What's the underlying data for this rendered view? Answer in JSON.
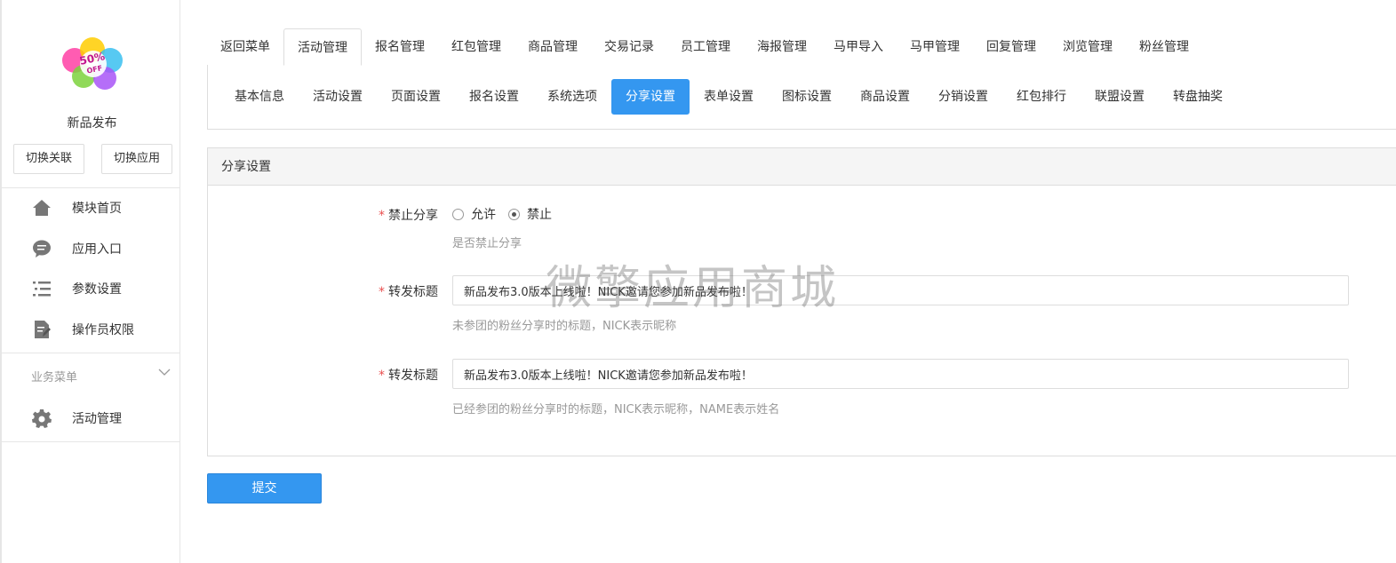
{
  "sidebar": {
    "app_name": "新品发布",
    "switch_link_label": "切换关联",
    "switch_app_label": "切换应用",
    "items": [
      {
        "label": "模块首页",
        "icon": "home-icon"
      },
      {
        "label": "应用入口",
        "icon": "chat-icon"
      },
      {
        "label": "参数设置",
        "icon": "list-icon"
      },
      {
        "label": "操作员权限",
        "icon": "document-edit-icon"
      }
    ],
    "business_menu_title": "业务菜单",
    "business_items": [
      {
        "label": "活动管理",
        "icon": "gear-icon"
      }
    ]
  },
  "top_tabs": [
    {
      "label": "返回菜单",
      "active": false
    },
    {
      "label": "活动管理",
      "active": true
    },
    {
      "label": "报名管理",
      "active": false
    },
    {
      "label": "红包管理",
      "active": false
    },
    {
      "label": "商品管理",
      "active": false
    },
    {
      "label": "交易记录",
      "active": false
    },
    {
      "label": "员工管理",
      "active": false
    },
    {
      "label": "海报管理",
      "active": false
    },
    {
      "label": "马甲导入",
      "active": false
    },
    {
      "label": "马甲管理",
      "active": false
    },
    {
      "label": "回复管理",
      "active": false
    },
    {
      "label": "浏览管理",
      "active": false
    },
    {
      "label": "粉丝管理",
      "active": false
    }
  ],
  "sub_tabs": [
    {
      "label": "基本信息",
      "active": false
    },
    {
      "label": "活动设置",
      "active": false
    },
    {
      "label": "页面设置",
      "active": false
    },
    {
      "label": "报名设置",
      "active": false
    },
    {
      "label": "系统选项",
      "active": false
    },
    {
      "label": "分享设置",
      "active": true
    },
    {
      "label": "表单设置",
      "active": false
    },
    {
      "label": "图标设置",
      "active": false
    },
    {
      "label": "商品设置",
      "active": false
    },
    {
      "label": "分销设置",
      "active": false
    },
    {
      "label": "红包排行",
      "active": false
    },
    {
      "label": "联盟设置",
      "active": false
    },
    {
      "label": "转盘抽奖",
      "active": false
    }
  ],
  "panel": {
    "title": "分享设置",
    "required_mark": "*",
    "disable_share": {
      "label": "禁止分享",
      "options": [
        {
          "label": "允许",
          "checked": false
        },
        {
          "label": "禁止",
          "checked": true
        }
      ],
      "help": "是否禁止分享"
    },
    "share_title_1": {
      "label": "转发标题",
      "value": "新品发布3.0版本上线啦！NICK邀请您参加新品发布啦！",
      "help": "未参团的粉丝分享时的标题，NICK表示昵称"
    },
    "share_title_2": {
      "label": "转发标题",
      "value": "新品发布3.0版本上线啦！NICK邀请您参加新品发布啦！",
      "help": "已经参团的粉丝分享时的标题，NICK表示昵称，NAME表示姓名"
    }
  },
  "submit_label": "提交",
  "watermark": "微擎应用商城",
  "colors": {
    "accent": "#3497f0",
    "required": "#e94f4f",
    "help_text": "#999999",
    "border": "#dddddd"
  }
}
